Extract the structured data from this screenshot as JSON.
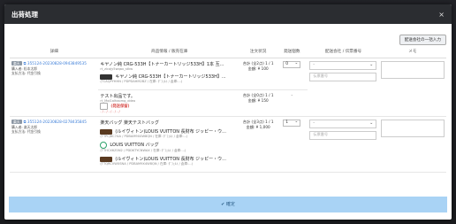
{
  "modal": {
    "title": "出荷処理",
    "close": "×"
  },
  "actions": {
    "batch_input": "配送会社の一括入力",
    "confirm": "✔ 確定"
  },
  "columns": [
    "詳細",
    "商品情報 / 販売在庫",
    "注文状況",
    "発送個数",
    "配送会社 / 伝票番号",
    "メモ"
  ],
  "orders": [
    {
      "badge": "楽天",
      "order_id": "355124-20230828-0943849535",
      "buyer_label": "購入者:",
      "buyer": "松本太郎",
      "payment_label": "支払方法:",
      "payment": "代金引換",
      "products": [
        {
          "title": "キヤノン純 CRG-533H【トナーカートリッジ533H】1本 互...",
          "sub": "rt_zicajy5wqax_stkw"
        },
        {
          "title": "キヤノン純 CRG-533H【トナーカートリッジ533H】...",
          "sub": "(TCAQPYHHN / PDPDAHM2BZ / 在庫: ﾀﾞﾌｪﾙﾄ / 倉庫:...)"
        }
      ],
      "status_line1": "合計 (全2点) 1 / 1",
      "status_line2": "金額: ¥ 100",
      "qty": "0",
      "carrier_placeholder": "-",
      "tracking_placeholder": "伝票番号",
      "extra": {
        "title": "テスト出品です。",
        "sub": "rt_Mql1alhaomg_ddeo",
        "stop": "(発送保留)",
        "dashes": "- / - / - / - / - /",
        "status_line1": "合計 (全0点) 1 / 1",
        "status_line2": "金額: ¥ 150",
        "qty": "-"
      }
    },
    {
      "badge": "楽天",
      "order_id": "355124-20230828-0278435845",
      "buyer_label": "購入者:",
      "buyer": "楽天太郎",
      "payment_label": "支払方法:",
      "payment": "代金引換",
      "products": [
        {
          "title": "楽天バッグ 楽天テストバッグ",
          "sub": ""
        },
        {
          "title": "(ルイヴィトン)LOUIS VUITTON 長財布 ジッピー・ウ...",
          "sub": "(TTPCJ6C7AA / PDBAM9X4W8QN / 在庫: ﾀﾞﾌｪﾙﾄ / 倉庫:...)"
        },
        {
          "title": "LOUIS VUITTON バッグ",
          "sub": "(TTHCX6Z0N2 / PDDKTYCNWAX / 在庫: ﾀﾞﾌｪﾙﾄ / 倉庫:...)"
        },
        {
          "title": "(ルイヴィトン)LOUIS VUITTON 長財布 ジッピー・ウ...",
          "sub": "(TTQRCVWXSNA / PDBAM9X4W8QN / 在庫: ﾀﾞﾌｪﾙﾄ / 倉庫:...)"
        }
      ],
      "status_line1": "合計 (全3点) 1 / 1",
      "status_line2": "金額: ¥ 1,000",
      "qty": "1",
      "carrier_placeholder": "-",
      "tracking_placeholder": "伝票番号"
    }
  ]
}
